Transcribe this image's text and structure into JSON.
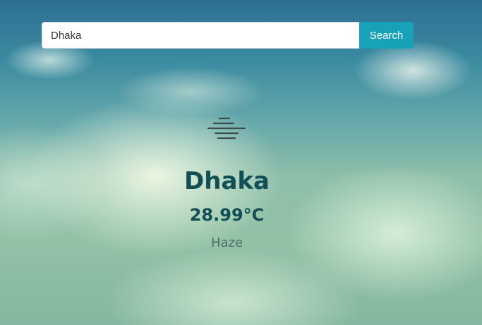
{
  "search": {
    "value": "Dhaka",
    "button_label": "Search"
  },
  "weather": {
    "icon": "haze-icon",
    "city": "Dhaka",
    "temperature": "28.99°C",
    "condition": "Haze"
  },
  "colors": {
    "button": "#17a2b8",
    "heading": "#114e55",
    "condition_text": "#4e6e6a"
  }
}
